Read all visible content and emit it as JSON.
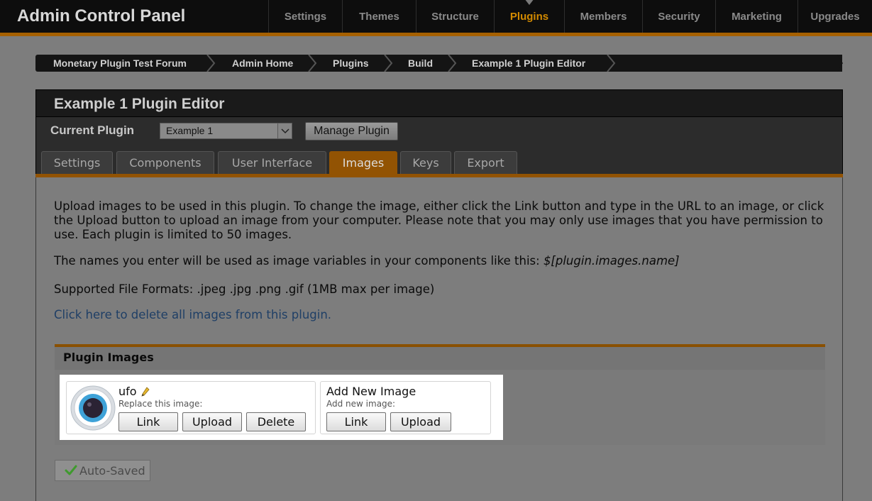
{
  "app": {
    "title": "Admin Control Panel"
  },
  "topnav": {
    "items": [
      {
        "label": "Settings"
      },
      {
        "label": "Themes"
      },
      {
        "label": "Structure"
      },
      {
        "label": "Plugins"
      },
      {
        "label": "Members"
      },
      {
        "label": "Security"
      },
      {
        "label": "Marketing"
      },
      {
        "label": "Upgrades"
      }
    ],
    "active": "Plugins"
  },
  "breadcrumb": {
    "items": [
      {
        "label": "Monetary Plugin Test Forum"
      },
      {
        "label": "Admin Home"
      },
      {
        "label": "Plugins"
      },
      {
        "label": "Build"
      },
      {
        "label": "Example 1 Plugin Editor"
      }
    ]
  },
  "panel": {
    "title": "Example 1 Plugin Editor",
    "current_plugin_label": "Current Plugin",
    "current_plugin_value": "Example 1",
    "manage_button": "Manage Plugin"
  },
  "tabs": [
    {
      "label": "Settings"
    },
    {
      "label": "Components"
    },
    {
      "label": "User Interface"
    },
    {
      "label": "Images"
    },
    {
      "label": "Keys"
    },
    {
      "label": "Export"
    }
  ],
  "active_tab": "Images",
  "content": {
    "intro": "Upload images to be used in this plugin. To change the image, either click the Link button and type in the URL to an image, or click the Upload button to upload an image from your computer. Please note that you may only use images that you have permission to use. Each plugin is limited to 50 images.",
    "variables_prefix": "The names you enter will be used as image variables in your components like this: ",
    "variables_example": "$[plugin.images.name]",
    "formats": "Supported File Formats: .jpeg .jpg .png .gif (1MB max per image)",
    "delete_link": "Click here to delete all images from this plugin."
  },
  "plugin_images": {
    "title": "Plugin Images",
    "image": {
      "name": "ufo",
      "sub": "Replace this image:",
      "link_button": "Link",
      "upload_button": "Upload",
      "delete_button": "Delete"
    },
    "new_image": {
      "title": "Add New Image",
      "sub": "Add new image:",
      "link_button": "Link",
      "upload_button": "Upload"
    }
  },
  "status": {
    "autosaved": "Auto-Saved"
  },
  "colors": {
    "accent": "#a66000",
    "active_tab": "#925303",
    "nav_active": "#d28a00"
  }
}
